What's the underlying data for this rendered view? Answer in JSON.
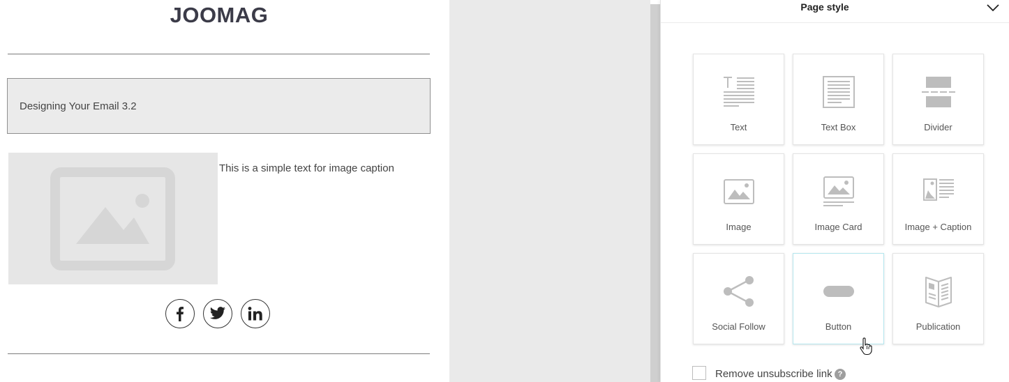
{
  "email": {
    "logo": "JOOMAG",
    "banner_text": "Designing Your Email 3.2",
    "image_caption": "This is a simple text for image caption",
    "social_icons": [
      "facebook-icon",
      "twitter-icon",
      "linkedin-icon"
    ]
  },
  "panel": {
    "title": "Page style",
    "tiles": [
      {
        "label": "Text",
        "icon": "text-block-icon"
      },
      {
        "label": "Text Box",
        "icon": "text-box-icon"
      },
      {
        "label": "Divider",
        "icon": "divider-icon"
      },
      {
        "label": "Image",
        "icon": "image-icon"
      },
      {
        "label": "Image Card",
        "icon": "image-card-icon"
      },
      {
        "label": "Image + Caption",
        "icon": "image-caption-icon"
      },
      {
        "label": "Social Follow",
        "icon": "share-icon"
      },
      {
        "label": "Button",
        "icon": "button-icon"
      },
      {
        "label": "Publication",
        "icon": "publication-icon"
      }
    ],
    "unsubscribe_label": "Remove unsubscribe link",
    "help_glyph": "?"
  }
}
